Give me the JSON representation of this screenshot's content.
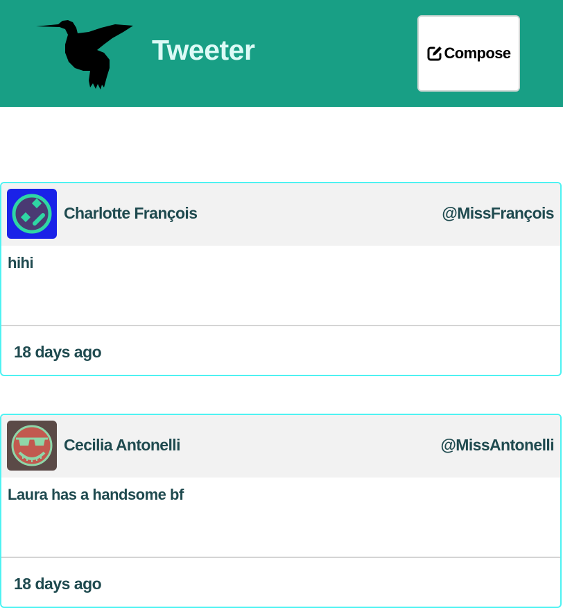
{
  "navbar": {
    "logo_icon": "hummingbird-icon",
    "brand": "Tweeter",
    "compose_label": "Compose",
    "compose_icon": "edit-icon",
    "background_color": "#189f85",
    "brand_color": "#dcfaf6"
  },
  "tweets": [
    {
      "avatar_icon": "face-avatar-icon",
      "name": "Charlotte François",
      "handle": "@MissFrançois",
      "content": "hihi",
      "time": "18 days ago"
    },
    {
      "avatar_icon": "sunglasses-smile-avatar-icon",
      "name": "Cecilia Antonelli",
      "handle": "@MissAntonelli",
      "content": "Laura has a handsome bf",
      "time": "18 days ago"
    }
  ],
  "colors": {
    "card_border": "#4ef2f2",
    "card_header": "#f2f2f2",
    "text": "#1f4a4f"
  }
}
